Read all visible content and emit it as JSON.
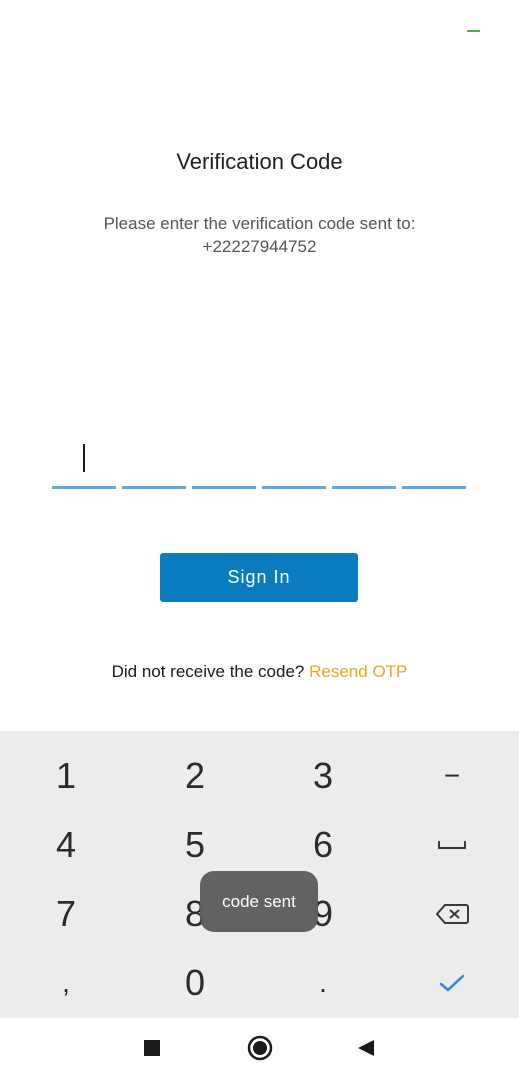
{
  "screen": {
    "title": "Verification Code",
    "instruction": "Please enter the verification code sent to:",
    "phone": "+22227944752"
  },
  "otp": {
    "boxes": 6,
    "filled": 0
  },
  "actions": {
    "sign_in_label": "Sign In",
    "resend_prompt": "Did not receive the code?",
    "resend_link": "Resend OTP"
  },
  "keyboard": {
    "keys": [
      "1",
      "2",
      "3",
      "−",
      "4",
      "5",
      "6",
      "␣",
      "7",
      "8",
      "9",
      "⌫",
      ",",
      "0",
      "."
    ],
    "done_icon": "check-icon",
    "space_icon": "space-icon",
    "backspace_icon": "backspace-icon"
  },
  "toast": {
    "message": "code sent"
  },
  "navigation": {
    "recents_icon": "square-icon",
    "home_icon": "circle-icon",
    "back_icon": "triangle-back-icon"
  },
  "colors": {
    "primary": "#0a7cbf",
    "accent": "#f0a51e",
    "otp_line": "#5aa9e0",
    "status": "#3bb54a"
  }
}
